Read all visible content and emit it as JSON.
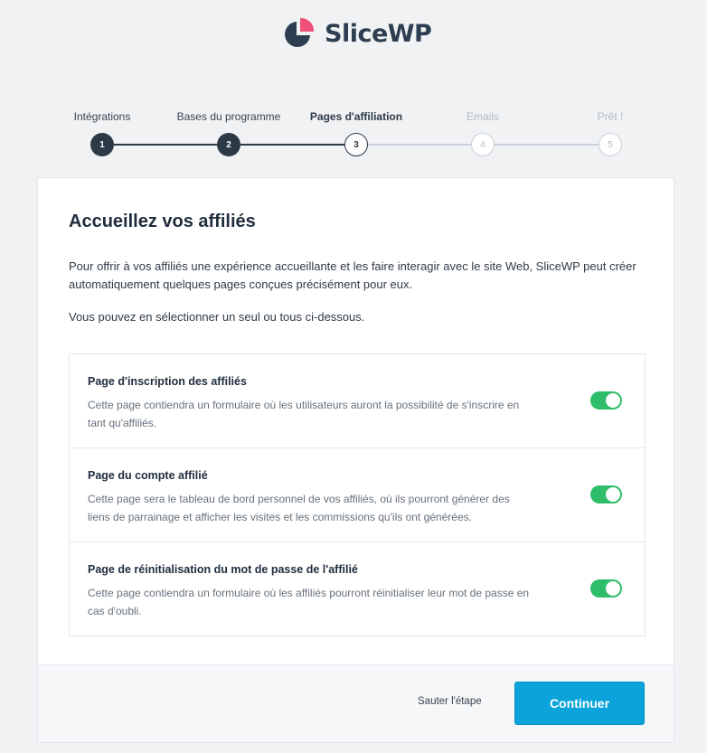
{
  "brand": {
    "name": "SliceWP",
    "icon": "slicewp-logo",
    "colors": {
      "dark": "#2c3e50",
      "accent": "#f0517b"
    }
  },
  "stepper": {
    "steps": [
      {
        "label": "Intégrations",
        "number": "1",
        "state": "done"
      },
      {
        "label": "Bases du programme",
        "number": "2",
        "state": "done"
      },
      {
        "label": "Pages d'affiliation",
        "number": "3",
        "state": "active"
      },
      {
        "label": "Emails",
        "number": "4",
        "state": "future"
      },
      {
        "label": "Prêt !",
        "number": "5",
        "state": "future"
      }
    ]
  },
  "card": {
    "title": "Accueillez vos affiliés",
    "intro": "Pour offrir à vos affiliés une expérience accueillante et les faire interagir avec le site Web, SliceWP peut créer automatiquement quelques pages conçues précisément pour eux.",
    "intro2": "Vous pouvez en sélectionner un seul ou tous ci-dessous.",
    "options": [
      {
        "title": "Page d'inscription des affiliés",
        "description": "Cette page contiendra un formulaire où les utilisateurs auront la possibilité de s'inscrire en tant qu'affiliés.",
        "enabled": true
      },
      {
        "title": "Page du compte affilié",
        "description": "Cette page sera le tableau de bord personnel de vos affiliés, où ils pourront générer des liens de parrainage et afficher les visites et les commissions qu'ils ont générées.",
        "enabled": true
      },
      {
        "title": "Page de réinitialisation du mot de passe de l'affilié",
        "description": "Cette page contiendra un formulaire où les affiliés pourront réinitialiser leur mot de passe en cas d'oubli.",
        "enabled": true
      }
    ]
  },
  "footer": {
    "skip_label": "Sauter l'étape",
    "continue_label": "Continuer"
  },
  "colors": {
    "toggle_on": "#2ebd6a",
    "primary_button": "#0aa4db",
    "step_done": "#2c3a47",
    "step_future": "#c9d1da"
  }
}
